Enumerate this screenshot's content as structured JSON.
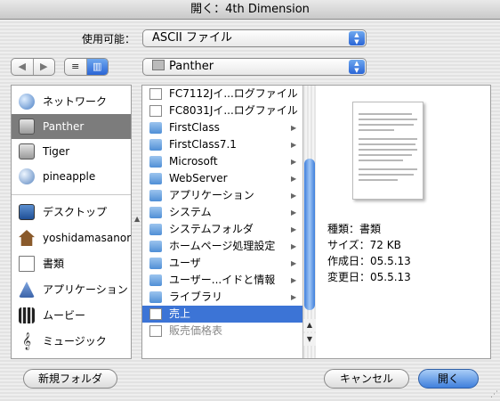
{
  "window": {
    "title": "開く：4th Dimension"
  },
  "filter": {
    "label": "使用可能：",
    "value": "ASCII ファイル"
  },
  "nav": {
    "back": "◀",
    "forward": "▶",
    "list_view": "≡",
    "column_view": "▥"
  },
  "location": {
    "value": "Panther"
  },
  "sidebar": {
    "items": [
      {
        "label": "ネットワーク",
        "icon": "network-globe-icon",
        "selected": false
      },
      {
        "label": "Panther",
        "icon": "hard-disk-icon",
        "selected": true
      },
      {
        "label": "Tiger",
        "icon": "hard-disk-icon",
        "selected": false
      },
      {
        "label": "pineapple",
        "icon": "network-disk-icon",
        "selected": false
      },
      {
        "label": "デスクトップ",
        "icon": "desktop-icon",
        "selected": false
      },
      {
        "label": "yoshidamasanori",
        "icon": "home-icon",
        "selected": false
      },
      {
        "label": "書類",
        "icon": "documents-icon",
        "selected": false
      },
      {
        "label": "アプリケーション",
        "icon": "applications-icon",
        "selected": false
      },
      {
        "label": "ムービー",
        "icon": "movies-icon",
        "selected": false
      },
      {
        "label": "ミュージック",
        "icon": "music-icon",
        "selected": false
      }
    ]
  },
  "files": [
    {
      "name": "FC7112Jイ...ログファイル",
      "kind": "document",
      "has_children": false,
      "selected": false,
      "disabled": false
    },
    {
      "name": "FC8031Jイ...ログファイル",
      "kind": "document",
      "has_children": false,
      "selected": false,
      "disabled": false
    },
    {
      "name": "FirstClass",
      "kind": "folder",
      "has_children": true,
      "selected": false,
      "disabled": false
    },
    {
      "name": "FirstClass7.1",
      "kind": "folder",
      "has_children": true,
      "selected": false,
      "disabled": false
    },
    {
      "name": "Microsoft",
      "kind": "folder",
      "has_children": true,
      "selected": false,
      "disabled": false
    },
    {
      "name": "WebServer",
      "kind": "folder",
      "has_children": true,
      "selected": false,
      "disabled": false
    },
    {
      "name": "アプリケーション",
      "kind": "folder",
      "has_children": true,
      "selected": false,
      "disabled": false
    },
    {
      "name": "システム",
      "kind": "folder",
      "has_children": true,
      "selected": false,
      "disabled": false
    },
    {
      "name": "システムフォルダ",
      "kind": "folder",
      "has_children": true,
      "selected": false,
      "disabled": false
    },
    {
      "name": "ホームページ処理設定",
      "kind": "folder",
      "has_children": true,
      "selected": false,
      "disabled": false
    },
    {
      "name": "ユーザ",
      "kind": "folder",
      "has_children": true,
      "selected": false,
      "disabled": false
    },
    {
      "name": "ユーザー...イドと情報",
      "kind": "folder",
      "has_children": true,
      "selected": false,
      "disabled": false
    },
    {
      "name": "ライブラリ",
      "kind": "folder",
      "has_children": true,
      "selected": false,
      "disabled": false
    },
    {
      "name": "売上",
      "kind": "document",
      "has_children": false,
      "selected": true,
      "disabled": false
    },
    {
      "name": "販売価格表",
      "kind": "document",
      "has_children": false,
      "selected": false,
      "disabled": true
    }
  ],
  "preview": {
    "kind": "種類：書類",
    "size": "サイズ：72 KB",
    "created": "作成日：05.5.13",
    "modified": "変更日：05.5.13"
  },
  "buttons": {
    "new_folder": "新規フォルダ",
    "cancel": "キャンセル",
    "open": "開く"
  },
  "colors": {
    "selection": "#3c74d6",
    "sidebar_selection": "#7c7c7c",
    "accent": "#3f7fdc"
  }
}
